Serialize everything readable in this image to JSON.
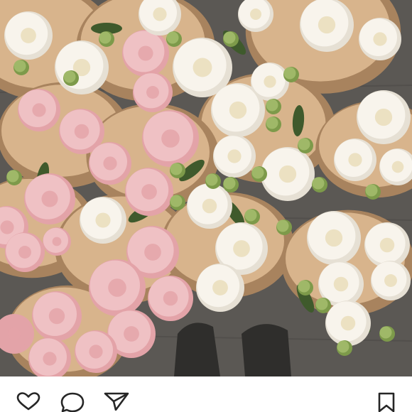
{
  "post": {
    "photo": {
      "subject": "peony-bouquets",
      "palette": {
        "ground": "#5b5854",
        "kraft_paper": "#d8b48c",
        "kraft_shadow": "#a8835e",
        "pink_petal": "#efc1c4",
        "pink_deep": "#e3a3a8",
        "white_petal": "#f8f4ec",
        "petal_center": "#e9dcb8",
        "bud_green": "#9fb868",
        "leaf_green": "#3f5a2c"
      }
    },
    "actions": {
      "like_icon": "heart-outline",
      "comment_icon": "speech-bubble-outline",
      "share_icon": "paper-plane-outline",
      "save_icon": "bookmark-outline",
      "icon_color": "#262626"
    }
  }
}
